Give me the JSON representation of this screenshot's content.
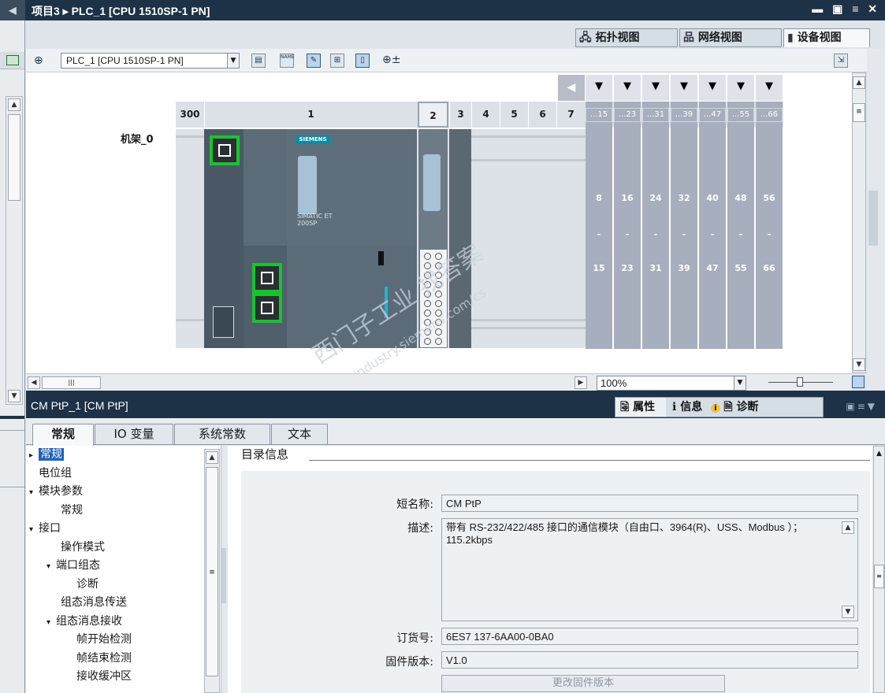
{
  "titlebar": {
    "back_glyph": "◀",
    "breadcrumb": "项目3 ▸ PLC_1 [CPU 1510SP-1 PN]",
    "window_controls": "▬ ▣ ≡ ✕"
  },
  "view_tabs": [
    {
      "label": "拓扑视图",
      "icon": "topology-icon"
    },
    {
      "label": "网络视图",
      "icon": "network-icon"
    },
    {
      "label": "设备视图",
      "icon": "device-icon"
    }
  ],
  "toolbar": {
    "device_select": "PLC_1 [CPU 1510SP-1 PN]",
    "name_icon_text": "NAME",
    "zoom_glyph": "⊕±"
  },
  "rack": {
    "rack_label": "机架_0",
    "slots_top": [
      "300",
      "1",
      "2",
      "3",
      "4",
      "5",
      "6",
      "7"
    ],
    "group_headers": [
      "...15",
      "...23",
      "...31",
      "...39",
      "...47",
      "...55",
      "...66"
    ],
    "group_start": [
      "8",
      "16",
      "24",
      "32",
      "40",
      "48",
      "56"
    ],
    "group_dash": [
      "-",
      "-",
      "-",
      "-",
      "-",
      "-",
      "-"
    ],
    "group_end": [
      "15",
      "23",
      "31",
      "39",
      "47",
      "55",
      "66"
    ],
    "cpu_brand": "SIEMENS",
    "cpu_name": "SIMATIC ET 200SP"
  },
  "hscroll": {
    "zoom": "100%"
  },
  "watermark": [
    "西门子工业 找答案",
    "support.industry.siemens.com/cs"
  ],
  "inspector": {
    "object_title": "CM PtP_1 [CM PtP]",
    "tabs": [
      {
        "label": "属性",
        "icon": "properties-icon"
      },
      {
        "label": "信息",
        "icon": "info-icon"
      },
      {
        "label": "诊断",
        "icon": "diagnostics-icon"
      }
    ],
    "subtabs": [
      "常规",
      "IO 变量",
      "系统常数",
      "文本"
    ]
  },
  "nav_tree": [
    {
      "label": "常规",
      "arrow": "▸",
      "selected": true
    },
    {
      "label": "电位组",
      "arrow": ""
    },
    {
      "label": "模块参数",
      "arrow": "▾"
    },
    {
      "label": "常规",
      "arrow": ""
    },
    {
      "label": "接口",
      "arrow": "▾"
    },
    {
      "label": "操作模式",
      "arrow": ""
    },
    {
      "label": "端口组态",
      "arrow": "▾"
    },
    {
      "label": "诊断",
      "arrow": ""
    },
    {
      "label": "组态消息传送",
      "arrow": ""
    },
    {
      "label": "组态消息接收",
      "arrow": "▾"
    },
    {
      "label": "帧开始检测",
      "arrow": ""
    },
    {
      "label": "帧结束检测",
      "arrow": ""
    },
    {
      "label": "接收缓冲区",
      "arrow": ""
    }
  ],
  "catalog": {
    "section_title": "目录信息",
    "short_name_label": "短名称:",
    "short_name": "CM PtP",
    "description_label": "描述:",
    "description": "带有 RS-232/422/485 接口的通信模块（自由口、3964(R)、USS、Modbus ）；115.2kbps",
    "order_label": "订货号:",
    "order_number": "6ES7 137-6AA00-0BA0",
    "firmware_label": "固件版本:",
    "firmware": "V1.0",
    "change_fw_button": "更改固件版本"
  },
  "colors": {
    "titlebar": "#1d3247",
    "module_dark": "#4a5965",
    "expansion_slot": "#a7aebd",
    "port_highlight": "#19c32c"
  }
}
